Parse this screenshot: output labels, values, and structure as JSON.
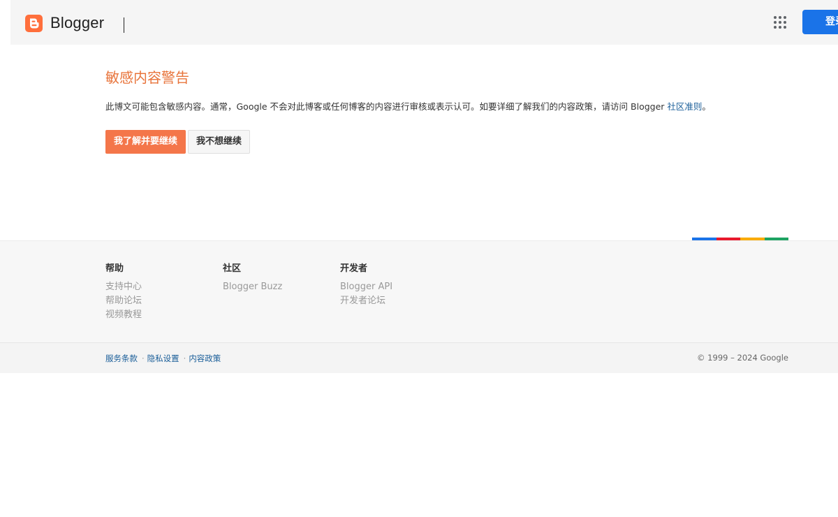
{
  "header": {
    "logo_text": "Blogger",
    "signin_label": "登录",
    "colors": {
      "logo": "#ff6f3c",
      "signin": "#1a73e8"
    }
  },
  "warning": {
    "title": "敏感内容警告",
    "text_before_link": "此博文可能包含敏感内容。通常，Google 不会对此博客或任何博客的内容进行审核或表示认可。如要详细了解我们的内容政策，请访问 Blogger ",
    "link_text": "社区准则",
    "text_after_link": "。",
    "continue_label": "我了解并要继续",
    "back_label": "我不想继续",
    "colors": {
      "title": "#e8743b",
      "continue_button": "#f4764a"
    }
  },
  "google_strip_colors": [
    "#1a73e8",
    "#e8192c",
    "#f9ab00",
    "#1ea362"
  ],
  "footer": {
    "columns": [
      {
        "heading": "帮助",
        "links": [
          "支持中心",
          "帮助论坛",
          "视频教程"
        ]
      },
      {
        "heading": "社区",
        "links": [
          "Blogger Buzz"
        ]
      },
      {
        "heading": "开发者",
        "links": [
          "Blogger API",
          "开发者论坛"
        ]
      }
    ]
  },
  "bottom": {
    "links": [
      "服务条款",
      "隐私设置",
      "内容政策"
    ],
    "separator": "·",
    "copyright": "© 1999 – 2024 Google"
  }
}
